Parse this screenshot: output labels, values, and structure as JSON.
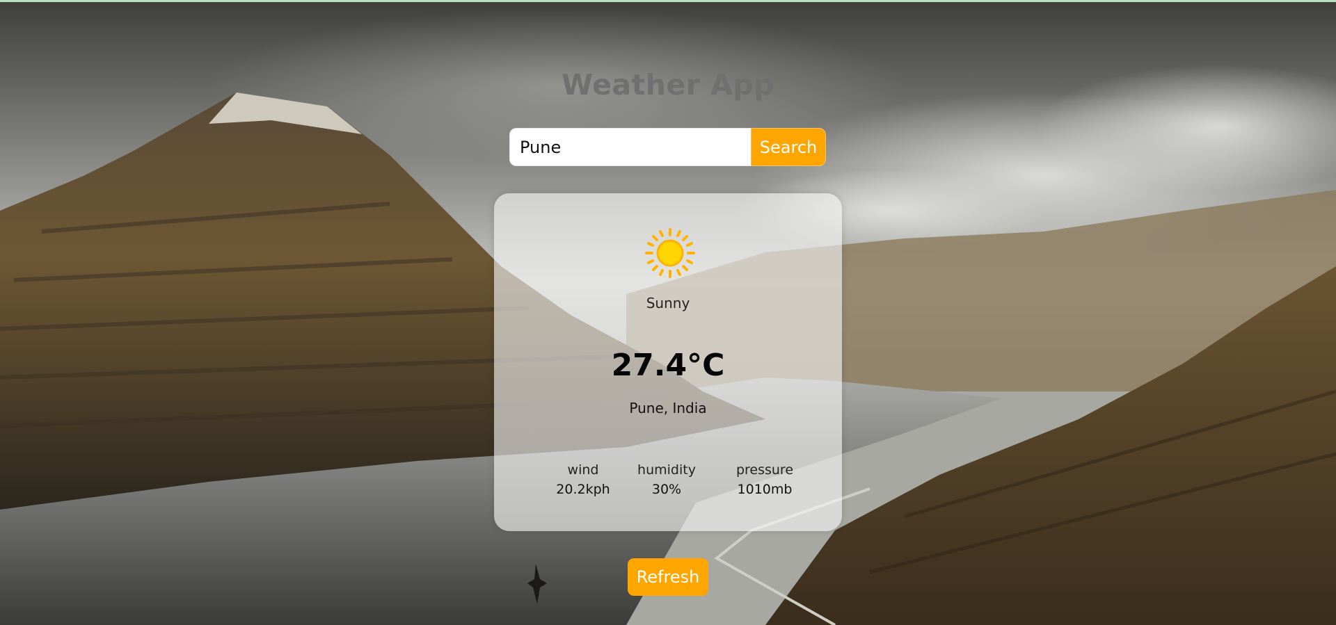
{
  "app": {
    "title": "Weather App"
  },
  "search": {
    "value": "Pune",
    "button_label": "Search"
  },
  "weather": {
    "icon": "sun-icon",
    "condition": "Sunny",
    "temperature": "27.4°C",
    "location": "Pune, India",
    "stats": [
      {
        "label": "wind",
        "value": "20.2kph"
      },
      {
        "label": "humidity",
        "value": "30%"
      },
      {
        "label": "pressure",
        "value": "1010mb"
      }
    ]
  },
  "actions": {
    "refresh_label": "Refresh"
  },
  "colors": {
    "accent": "#ffa500",
    "title": "#707070",
    "card": "#f5f5f5"
  }
}
